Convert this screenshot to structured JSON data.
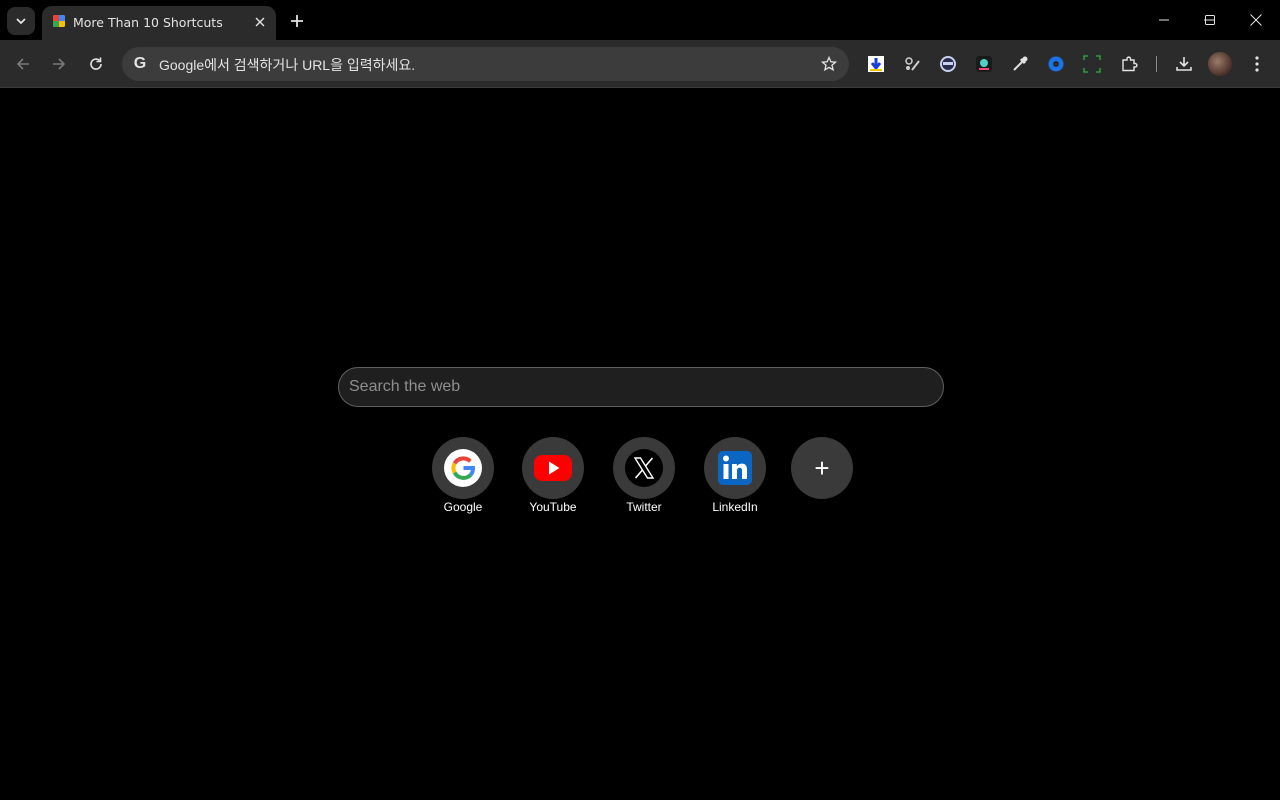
{
  "browser": {
    "tab": {
      "title": "More Than 10 Shortcuts"
    },
    "omnibox": {
      "placeholder": "Google에서 검색하거나 URL을 입력하세요."
    }
  },
  "page": {
    "search": {
      "placeholder": "Search the web"
    },
    "shortcuts": [
      {
        "label": "Google",
        "icon": "google-icon"
      },
      {
        "label": "YouTube",
        "icon": "youtube-icon"
      },
      {
        "label": "Twitter",
        "icon": "x-twitter-icon"
      },
      {
        "label": "LinkedIn",
        "icon": "linkedin-icon"
      }
    ],
    "add_label": "+"
  },
  "colors": {
    "background": "#000000",
    "toolbar": "#2b2b2b",
    "omnibox": "#3c3c3c",
    "shortcut_circle": "#3a3a3a",
    "youtube_red": "#ff0000",
    "linkedin_blue": "#0a66c2"
  }
}
